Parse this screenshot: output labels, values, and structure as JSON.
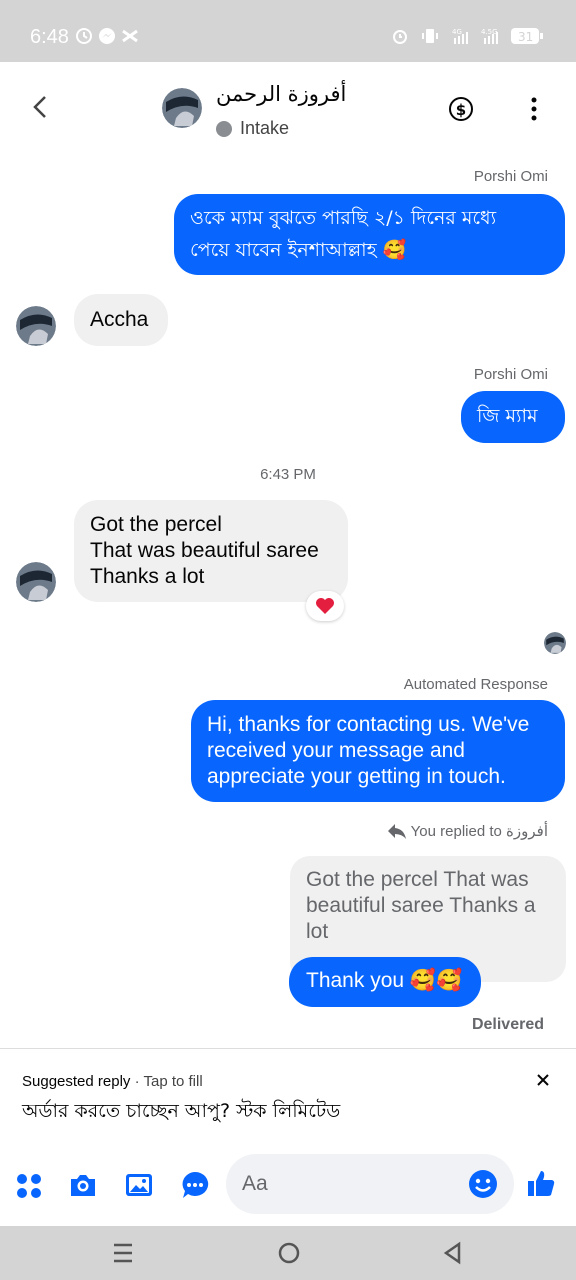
{
  "status_bar": {
    "time": "6:48",
    "network": "4G",
    "network2": "4.5G",
    "battery": "31"
  },
  "header": {
    "contact_name": "أفروزة الرحمن",
    "label_status": "Intake"
  },
  "messages": [
    {
      "type": "outgoing",
      "sender": "Porshi Omi",
      "lines": [
        "ওকে ম্যাম বুঝতে পারছি ২/১ দিনের মধ্যে",
        "পেয়ে যাবেন ইনশাআল্লাহ 🥰"
      ]
    },
    {
      "type": "incoming",
      "lines": [
        "Accha"
      ]
    },
    {
      "type": "outgoing",
      "sender": "Porshi Omi",
      "lines": [
        "জি ম্যাম"
      ]
    },
    {
      "type": "timestamp",
      "text": "6:43 PM"
    },
    {
      "type": "incoming",
      "lines": [
        "Got the percel",
        "That was beautiful saree",
        "Thanks a lot"
      ],
      "reaction": "heart"
    },
    {
      "type": "outgoing",
      "sender": "Automated Response",
      "lines": [
        "Hi, thanks for contacting us. We've",
        "received your message and",
        "appreciate your getting in touch."
      ]
    },
    {
      "type": "reply_note",
      "text": "You replied to أفروزة"
    },
    {
      "type": "quoted",
      "lines": [
        "Got the percel",
        "That was beautiful saree",
        "Thanks a lot"
      ]
    },
    {
      "type": "outgoing",
      "lines": [
        "Thank you 🥰🥰"
      ]
    }
  ],
  "delivery_status": "Delivered",
  "suggested_reply": {
    "title": "Suggested reply",
    "hint": "Tap to fill",
    "text": "অর্ডার করতে চাচ্ছেন আপু? স্টক লিমিটেড"
  },
  "composer": {
    "placeholder": "Aa"
  },
  "colors": {
    "accent": "#0866ff",
    "incoming_bubble": "#f0f0f0",
    "system_bar": "#d4d4d4"
  }
}
